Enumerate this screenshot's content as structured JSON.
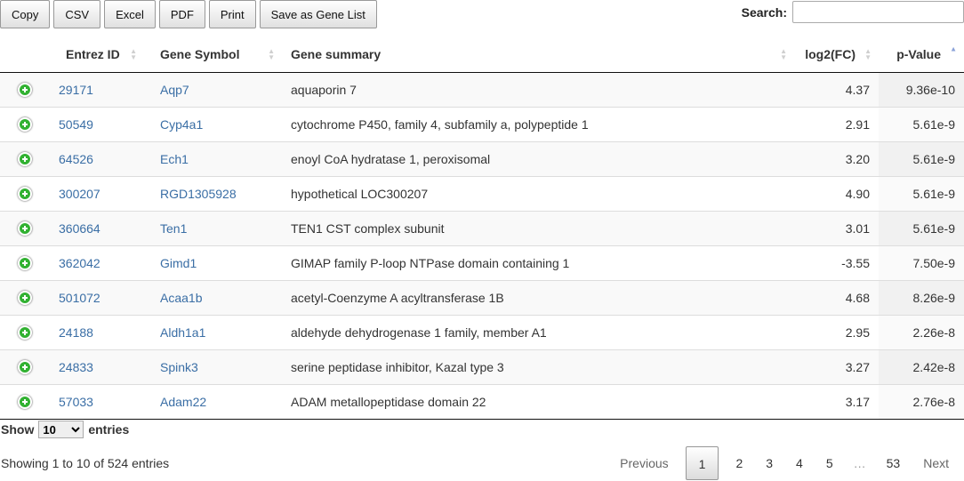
{
  "toolbar": {
    "buttons": [
      "Copy",
      "CSV",
      "Excel",
      "PDF",
      "Print",
      "Save as Gene List"
    ]
  },
  "search": {
    "label": "Search:",
    "value": "",
    "placeholder": ""
  },
  "table": {
    "columns": [
      "",
      "Entrez ID",
      "Gene Symbol",
      "Gene summary",
      "log2(FC)",
      "p-Value"
    ],
    "rows": [
      {
        "entrez": "29171",
        "symbol": "Aqp7",
        "summary": "aquaporin 7",
        "fc": "4.37",
        "p": "9.36e-10"
      },
      {
        "entrez": "50549",
        "symbol": "Cyp4a1",
        "summary": "cytochrome P450, family 4, subfamily a, polypeptide 1",
        "fc": "2.91",
        "p": "5.61e-9"
      },
      {
        "entrez": "64526",
        "symbol": "Ech1",
        "summary": "enoyl CoA hydratase 1, peroxisomal",
        "fc": "3.20",
        "p": "5.61e-9"
      },
      {
        "entrez": "300207",
        "symbol": "RGD1305928",
        "summary": "hypothetical LOC300207",
        "fc": "4.90",
        "p": "5.61e-9"
      },
      {
        "entrez": "360664",
        "symbol": "Ten1",
        "summary": "TEN1 CST complex subunit",
        "fc": "3.01",
        "p": "5.61e-9"
      },
      {
        "entrez": "362042",
        "symbol": "Gimd1",
        "summary": "GIMAP family P-loop NTPase domain containing 1",
        "fc": "-3.55",
        "p": "7.50e-9"
      },
      {
        "entrez": "501072",
        "symbol": "Acaa1b",
        "summary": "acetyl-Coenzyme A acyltransferase 1B",
        "fc": "4.68",
        "p": "8.26e-9"
      },
      {
        "entrez": "24188",
        "symbol": "Aldh1a1",
        "summary": "aldehyde dehydrogenase 1 family, member A1",
        "fc": "2.95",
        "p": "2.26e-8"
      },
      {
        "entrez": "24833",
        "symbol": "Spink3",
        "summary": "serine peptidase inhibitor, Kazal type 3",
        "fc": "3.27",
        "p": "2.42e-8"
      },
      {
        "entrez": "57033",
        "symbol": "Adam22",
        "summary": "ADAM metallopeptidase domain 22",
        "fc": "3.17",
        "p": "2.76e-8"
      }
    ]
  },
  "length": {
    "show": "Show",
    "selected": "10",
    "entries": "entries"
  },
  "info": "Showing 1 to 10 of 524 entries",
  "paging": {
    "previous": "Previous",
    "pages": [
      "1",
      "2",
      "3",
      "4",
      "5"
    ],
    "ellipsis": "…",
    "last": "53",
    "next": "Next"
  },
  "colors": {
    "link": "#3a6ea5",
    "expand_icon": "#31b131",
    "sort_active": "#8aa2d8"
  }
}
